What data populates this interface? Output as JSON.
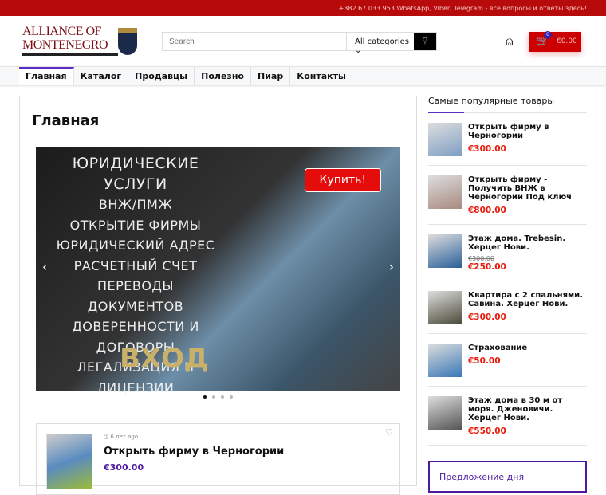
{
  "topbar": {
    "text": "+382 67 033 953 WhatsApp, Viber, Telegram - все вопросы и ответы здесь!"
  },
  "logo": {
    "line1": "ALLIANCE OF",
    "line2": "MONTENEGRO"
  },
  "search": {
    "placeholder": "Search",
    "category": "All categories"
  },
  "cart": {
    "count": "0",
    "total": "€0.00"
  },
  "nav": [
    "Главная",
    "Каталог",
    "Продавцы",
    "Полезно",
    "Пиар",
    "Контакты"
  ],
  "main": {
    "title": "Главная",
    "slider": {
      "lines": [
        "ЮРИДИЧЕСКИЕ УСЛУГИ",
        "ВНЖ/ПМЖ",
        "ОТКРЫТИЕ ФИРМЫ",
        "ЮРИДИЧЕСКИЙ АДРЕС",
        "РАСЧЕТНЫЙ СЧЕТ",
        "ПЕРЕВОДЫ ДОКУМЕНТОВ",
        "ДОВЕРЕННОСТИ И ДОГОВОРЫ",
        "ЛЕГАЛИЗАЦИЯ И ЛИЦЕНЗИИ"
      ],
      "buy": "Купить!",
      "sign": "ВХОД"
    },
    "card": {
      "date": "6 лет ago",
      "title": "Открыть фирму в Черногории",
      "price": "€300.00"
    }
  },
  "sidebar": {
    "title": "Самые популярные товары",
    "items": [
      {
        "name": "Открыть фирму в Черногории",
        "price": "€300.00",
        "color": "#7f9fc4"
      },
      {
        "name": "Открыть фирму - Получить ВНЖ в Черногории Под ключ",
        "price": "€800.00",
        "color": "#a88a80"
      },
      {
        "name": "Этаж дома. Trebesin. Херцег Нови.",
        "old": "€300.00",
        "price": "€250.00",
        "color": "#2a5f9a"
      },
      {
        "name": "Квартира с 2 спальнями. Савина. Херцег Нови.",
        "price": "€300.00",
        "color": "#4a4a3a"
      },
      {
        "name": "Страхование",
        "price": "€50.00",
        "color": "#3a78b8"
      },
      {
        "name": "Этаж дома в 30 м от моря. Дженовичи. Херцег Нови.",
        "price": "€550.00",
        "color": "#555"
      }
    ],
    "deal": "Предложение дня"
  }
}
